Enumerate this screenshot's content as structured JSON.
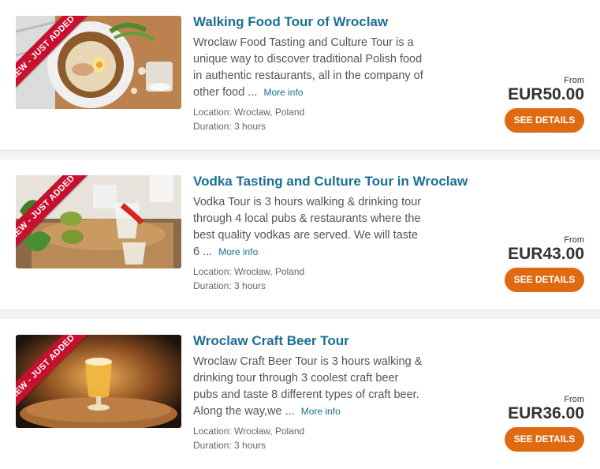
{
  "tours": [
    {
      "badge": "NEW - JUST ADDED",
      "title": "Walking Food Tour of Wroclaw",
      "description": "Wroclaw Food Tasting and Culture Tour is a unique way to discover traditional Polish food in authentic restaurants, all in the company of other food ...",
      "more_info": "More info",
      "location": "Location: Wroclaw, Poland",
      "duration": "Duration: 3 hours",
      "from": "From",
      "price": "EUR50.00",
      "button": "SEE DETAILS"
    },
    {
      "badge": "NEW - JUST ADDED",
      "title": "Vodka Tasting and Culture Tour in Wroclaw",
      "description": "Vodka Tour is 3 hours walking & drinking tour through 4 local pubs & restaurants where the best quality vodkas are served. We will taste 6 ...",
      "more_info": "More info",
      "location": "Location: Wrocław, Poland",
      "duration": "Duration: 3 hours",
      "from": "From",
      "price": "EUR43.00",
      "button": "SEE DETAILS"
    },
    {
      "badge": "NEW - JUST ADDED",
      "title": "Wroclaw Craft Beer Tour",
      "description": "Wroclaw Craft Beer Tour is 3 hours walking & drinking tour through 3 coolest craft beer pubs and taste 8 different types of craft beer. Along the way,we ...",
      "more_info": "More info",
      "location": "Location: Wrocław, Poland",
      "duration": "Duration: 3 hours",
      "from": "From",
      "price": "EUR36.00",
      "button": "SEE DETAILS"
    }
  ],
  "colors": {
    "title": "#1a6f96",
    "button": "#e06a12",
    "ribbon": "#c8102e"
  }
}
